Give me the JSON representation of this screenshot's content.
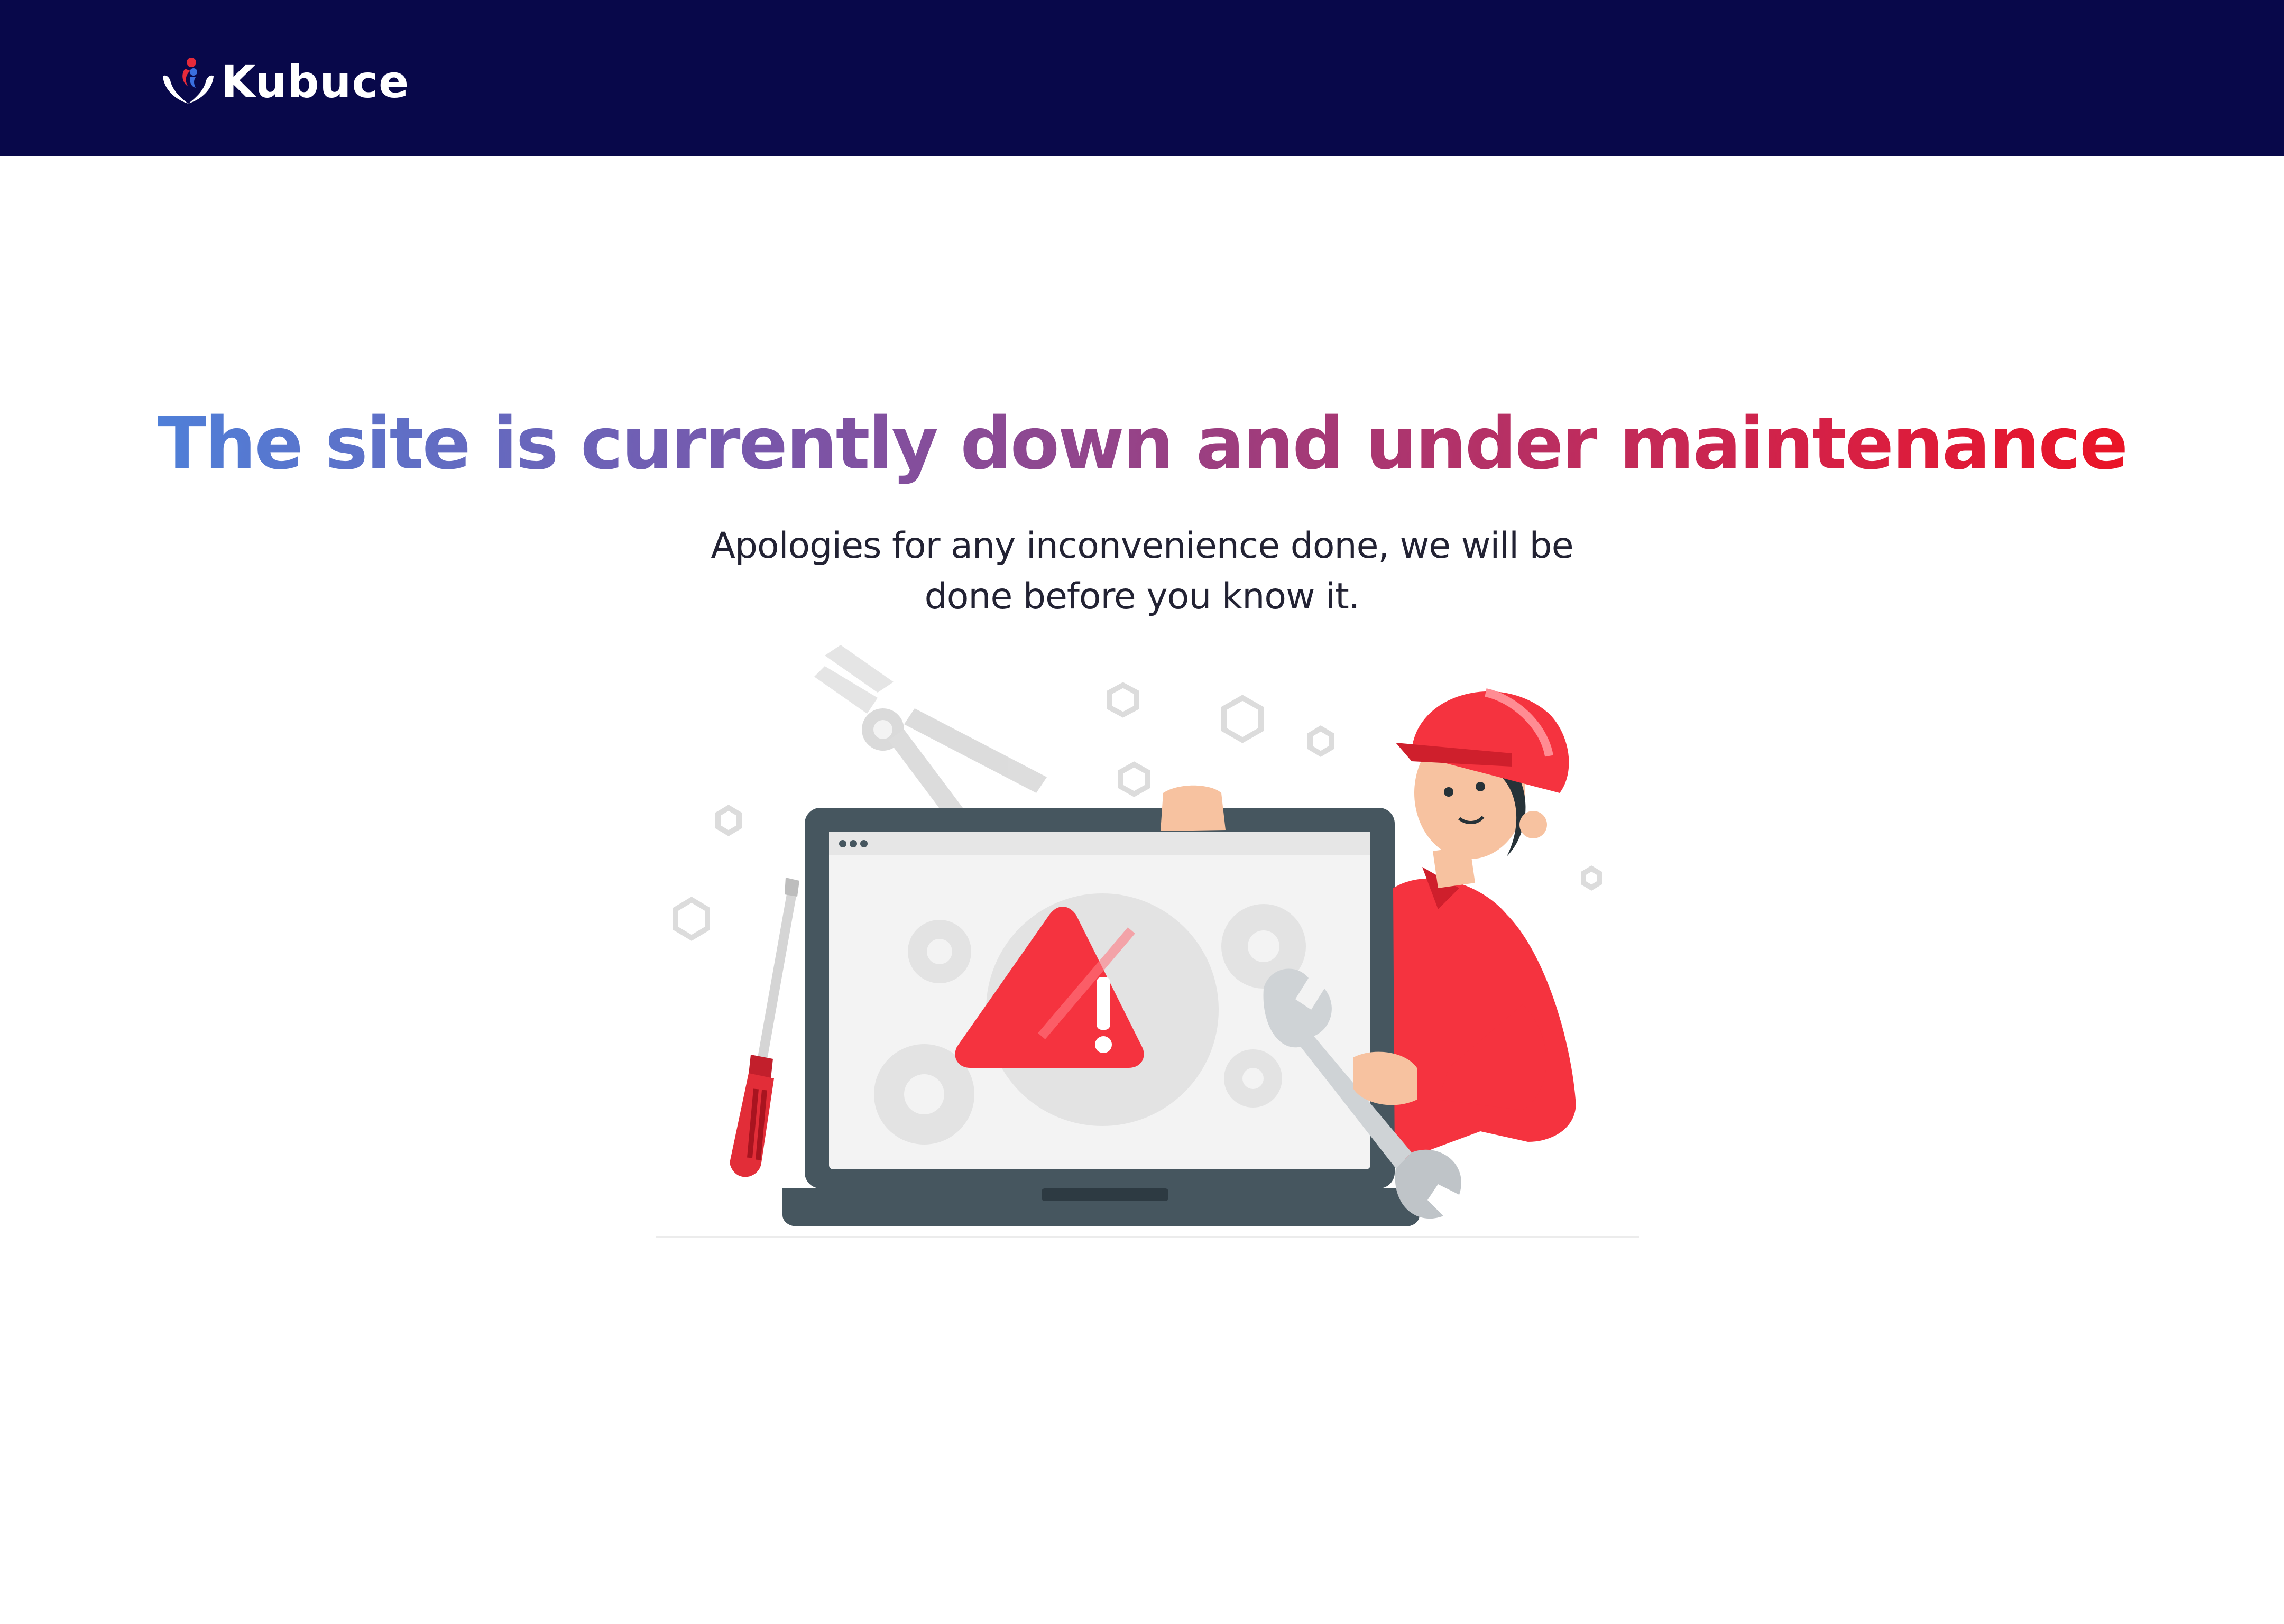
{
  "header": {
    "brand_name": "Kubuce",
    "logo_icon": "kubuce-hands-logo-icon",
    "background_color": "#08084a"
  },
  "main": {
    "headline": "The site is currently down and under maintenance",
    "headline_gradient": [
      "#4f7fd8",
      "#7a55a8",
      "#a33a78",
      "#d62045",
      "#ea1426"
    ],
    "subtitle": "Apologies for any inconvenience done, we will be done before you know it."
  },
  "illustration": {
    "description_icon": "maintenance-worker-laptop-illustration",
    "accent_color": "#f5333f",
    "warning_symbol": "!"
  }
}
